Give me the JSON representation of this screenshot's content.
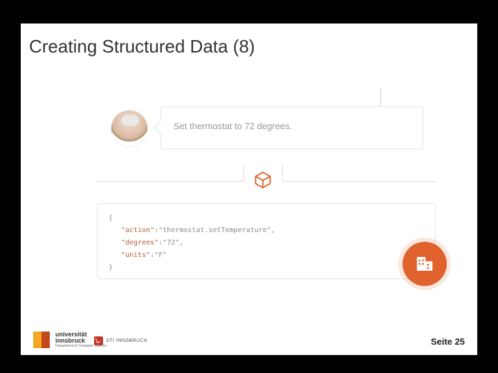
{
  "title": "Creating Structured Data (8)",
  "chat": {
    "user_utterance": "Set thermostat to 72 degrees."
  },
  "pipeline": {
    "center_icon": "package-box"
  },
  "json_output": {
    "lines": [
      {
        "brace": "{"
      },
      {
        "key": "\"action\"",
        "sep": ":",
        "val": "\"thermostat.setTemperature\"",
        "comma": ","
      },
      {
        "key": "\"degrees\"",
        "sep": ":",
        "val": "\"72\"",
        "comma": ","
      },
      {
        "key": "\"units\"",
        "sep": ":",
        "val": "\"F\"",
        "comma": ""
      },
      {
        "brace": "}"
      }
    ]
  },
  "device_badge_icon": "building-thermostat",
  "footer": {
    "uni_name_line1": "universität",
    "uni_name_line2": "innsbruck",
    "uni_dept": "Department of Computer Science",
    "sti_label": "STI INNSBRUCK",
    "page_prefix": "Seite ",
    "page_number": "25"
  }
}
